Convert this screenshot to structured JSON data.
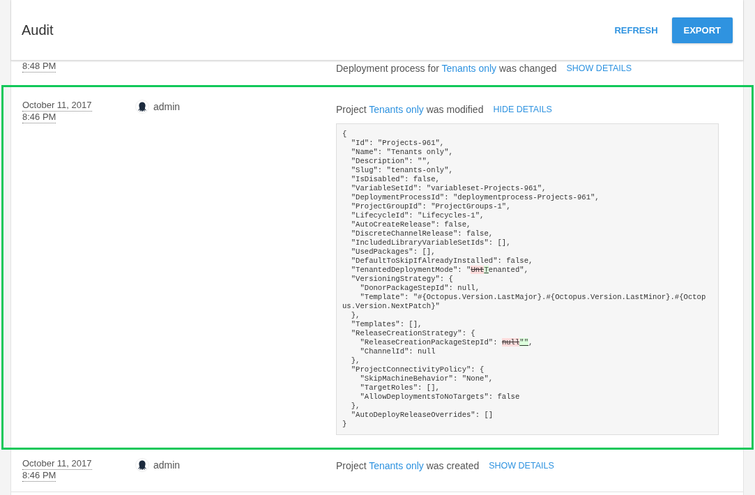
{
  "header": {
    "title": "Audit",
    "actions": [
      {
        "label": "REFRESH",
        "kind": "link"
      },
      {
        "label": "EXPORT",
        "kind": "primary"
      }
    ]
  },
  "entries": [
    {
      "time": "8:48 PM",
      "highlighted": false,
      "message": {
        "before": "Deployment process for",
        "link": "Tenants only",
        "after": "was changed"
      },
      "toggle": "SHOW DETAILS"
    },
    {
      "date": "October 11, 2017",
      "time": "8:46 PM",
      "user": "admin",
      "highlighted": true,
      "message": {
        "before": "Project",
        "link": "Tenants only",
        "after": "was modified"
      },
      "toggle": "HIDE DETAILS",
      "details": [
        {
          "text": "{"
        },
        {
          "text": "  \"Id\": \"Projects-961\","
        },
        {
          "text": "  \"Name\": \"Tenants only\","
        },
        {
          "text": "  \"Description\": \"\","
        },
        {
          "text": "  \"Slug\": \"tenants-only\","
        },
        {
          "text": "  \"IsDisabled\": false,"
        },
        {
          "text": "  \"VariableSetId\": \"variableset-Projects-961\","
        },
        {
          "text": "  \"DeploymentProcessId\": \"deploymentprocess-Projects-961\","
        },
        {
          "text": "  \"ProjectGroupId\": \"ProjectGroups-1\","
        },
        {
          "text": "  \"LifecycleId\": \"Lifecycles-1\","
        },
        {
          "text": "  \"AutoCreateRelease\": false,"
        },
        {
          "text": "  \"DiscreteChannelRelease\": false,"
        },
        {
          "text": "  \"IncludedLibraryVariableSetIds\": [],"
        },
        {
          "text": "  \"UsedPackages\": [],"
        },
        {
          "text": "  \"DefaultToSkipIfAlreadyInstalled\": false,"
        },
        {
          "parts": [
            {
              "text": "  \"TenantedDeploymentMode\": \"",
              "kind": "plain"
            },
            {
              "text": "Unt",
              "kind": "removed"
            },
            {
              "text": "T",
              "kind": "added"
            },
            {
              "text": "enanted\",",
              "kind": "plain"
            }
          ]
        },
        {
          "text": "  \"VersioningStrategy\": {"
        },
        {
          "text": "    \"DonorPackageStepId\": null,"
        },
        {
          "text": "    \"Template\": \"#{Octopus.Version.LastMajor}.#{Octopus.Version.LastMinor}.#{Octopus.Version.NextPatch}\""
        },
        {
          "text": "  },"
        },
        {
          "text": "  \"Templates\": [],"
        },
        {
          "text": "  \"ReleaseCreationStrategy\": {"
        },
        {
          "parts": [
            {
              "text": "    \"ReleaseCreationPackageStepId\": ",
              "kind": "plain"
            },
            {
              "text": "null",
              "kind": "removed"
            },
            {
              "text": "\"\"",
              "kind": "added"
            },
            {
              "text": ",",
              "kind": "plain"
            }
          ]
        },
        {
          "text": "    \"ChannelId\": null"
        },
        {
          "text": "  },"
        },
        {
          "text": "  \"ProjectConnectivityPolicy\": {"
        },
        {
          "text": "    \"SkipMachineBehavior\": \"None\","
        },
        {
          "text": "    \"TargetRoles\": [],"
        },
        {
          "text": "    \"AllowDeploymentsToNoTargets\": false"
        },
        {
          "text": "  },"
        },
        {
          "text": "  \"AutoDeployReleaseOverrides\": []"
        },
        {
          "text": "}"
        }
      ]
    },
    {
      "date": "October 11, 2017",
      "time": "8:46 PM",
      "user": "admin",
      "highlighted": false,
      "message": {
        "before": "Project",
        "link": "Tenants only",
        "after": "was created"
      },
      "toggle": "SHOW DETAILS"
    }
  ]
}
